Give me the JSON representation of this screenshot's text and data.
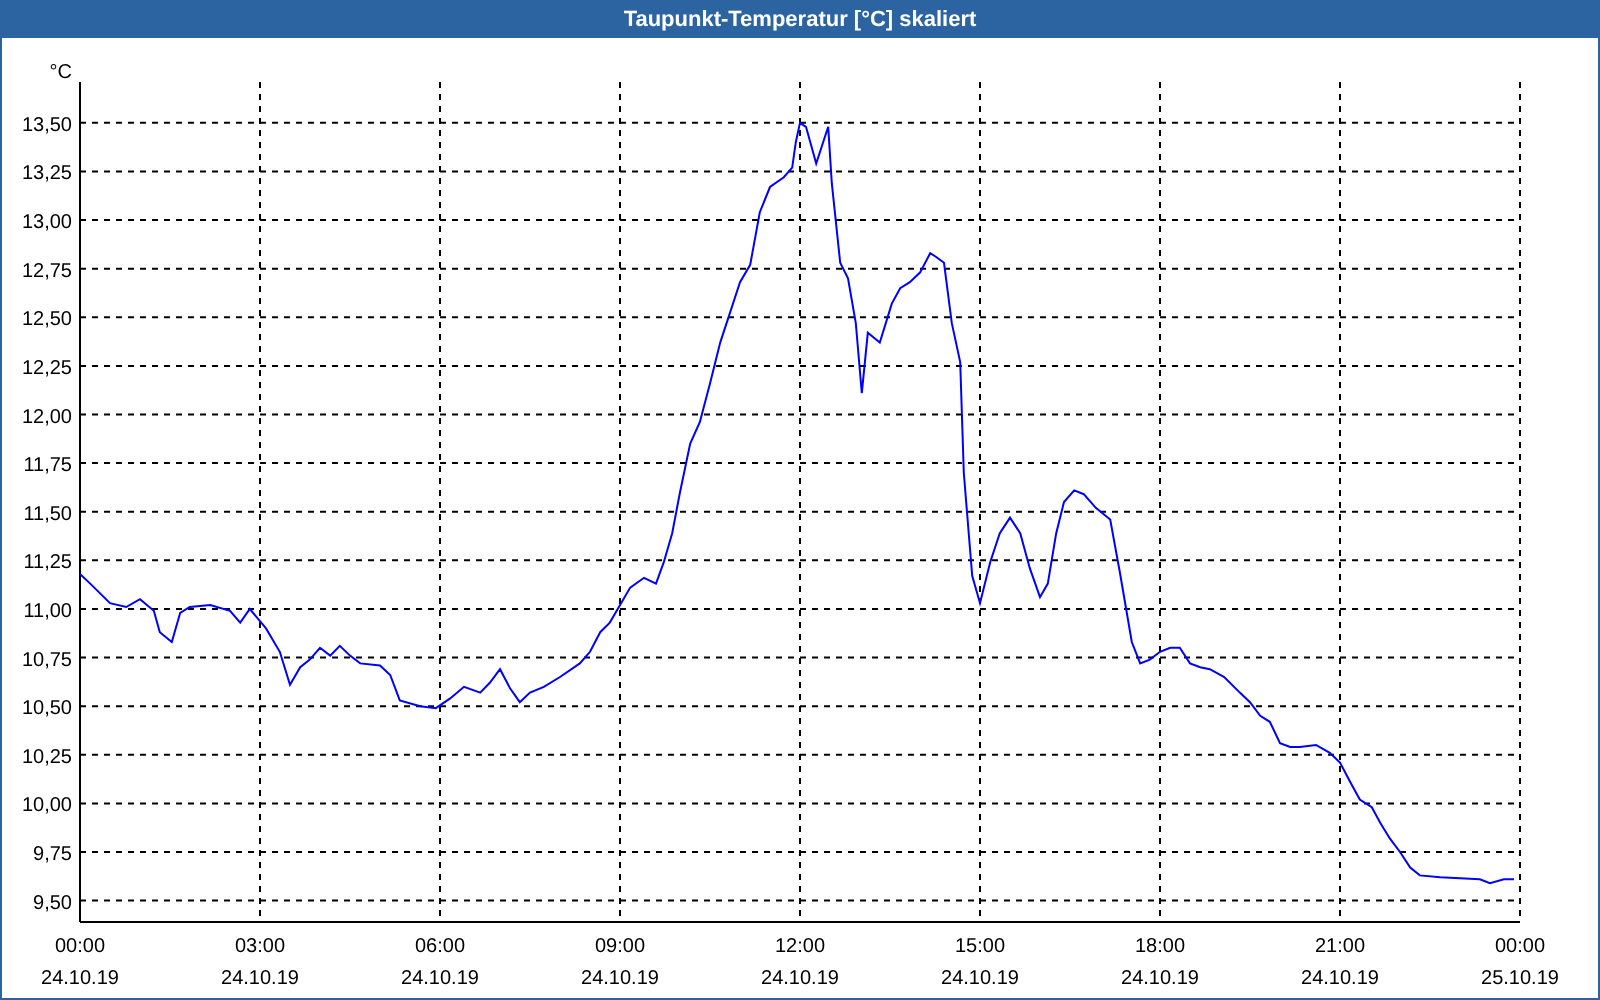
{
  "window": {
    "title": "Taupunkt-Temperatur [°C] skaliert"
  },
  "chart": {
    "chart_data": {
      "type": "line",
      "grid": true,
      "ylabel": "°C",
      "xlim": [
        0,
        24
      ],
      "ylim": [
        9.39,
        13.71
      ],
      "yticks": [
        {
          "value": 9.5,
          "label": "9,50"
        },
        {
          "value": 9.75,
          "label": "9,75"
        },
        {
          "value": 10,
          "label": "10,00"
        },
        {
          "value": 10.25,
          "label": "10,25"
        },
        {
          "value": 10.5,
          "label": "10,50"
        },
        {
          "value": 10.75,
          "label": "10,75"
        },
        {
          "value": 11,
          "label": "11,00"
        },
        {
          "value": 11.25,
          "label": "11,25"
        },
        {
          "value": 11.5,
          "label": "11,50"
        },
        {
          "value": 11.75,
          "label": "11,75"
        },
        {
          "value": 12,
          "label": "12,00"
        },
        {
          "value": 12.25,
          "label": "12,25"
        },
        {
          "value": 12.5,
          "label": "12,50"
        },
        {
          "value": 12.75,
          "label": "12,75"
        },
        {
          "value": 13,
          "label": "13,00"
        },
        {
          "value": 13.25,
          "label": "13,25"
        },
        {
          "value": 13.5,
          "label": "13,50"
        }
      ],
      "xticks": [
        {
          "value": 0,
          "label": "00:00"
        },
        {
          "value": 3,
          "label": "03:00"
        },
        {
          "value": 6,
          "label": "06:00"
        },
        {
          "value": 9,
          "label": "09:00"
        },
        {
          "value": 12,
          "label": "12:00"
        },
        {
          "value": 15,
          "label": "15:00"
        },
        {
          "value": 18,
          "label": "18:00"
        },
        {
          "value": 21,
          "label": "21:00"
        },
        {
          "value": 24,
          "label": "00:00"
        }
      ],
      "x": [
        0,
        0.17,
        0.5,
        0.77,
        1,
        1.23,
        1.33,
        1.53,
        1.67,
        1.83,
        2.17,
        2.5,
        2.67,
        2.83,
        3.1,
        3.33,
        3.5,
        3.67,
        3.83,
        4,
        4.17,
        4.33,
        4.5,
        4.67,
        5,
        5.17,
        5.33,
        5.67,
        5.93,
        6.17,
        6.4,
        6.67,
        6.83,
        7,
        7.17,
        7.33,
        7.5,
        7.73,
        8,
        8.33,
        8.5,
        8.67,
        8.83,
        9.17,
        9.4,
        9.6,
        9.73,
        9.87,
        10,
        10.17,
        10.33,
        10.5,
        10.67,
        10.83,
        11,
        11.17,
        11.33,
        11.5,
        11.73,
        11.87,
        11.93,
        12,
        12.1,
        12.27,
        12.47,
        12.53,
        12.67,
        12.8,
        12.93,
        13.03,
        13.13,
        13.33,
        13.53,
        13.67,
        13.83,
        14,
        14.17,
        14.27,
        14.4,
        14.53,
        14.67,
        14.73,
        14.87,
        15,
        15.17,
        15.33,
        15.5,
        15.67,
        15.83,
        16,
        16.13,
        16.27,
        16.4,
        16.57,
        16.73,
        16.93,
        17.17,
        17.33,
        17.53,
        17.67,
        17.83,
        18,
        18.17,
        18.33,
        18.5,
        18.67,
        18.83,
        19.07,
        19.33,
        19.5,
        19.67,
        19.83,
        20,
        20.17,
        20.33,
        20.6,
        20.83,
        21,
        21.17,
        21.33,
        21.53,
        21.67,
        21.83,
        22,
        22.17,
        22.33,
        22.67,
        23.33,
        23.5,
        23.73,
        23.9
      ],
      "series": [
        {
          "color": "#0000ff",
          "values": [
            11.18,
            11.13,
            11.03,
            11.01,
            11.05,
            10.99,
            10.88,
            10.83,
            10.98,
            11.01,
            11.02,
            10.99,
            10.93,
            11.0,
            10.9,
            10.78,
            10.61,
            10.7,
            10.74,
            10.8,
            10.76,
            10.81,
            10.76,
            10.72,
            10.71,
            10.66,
            10.53,
            10.5,
            10.49,
            10.54,
            10.6,
            10.57,
            10.62,
            10.69,
            10.59,
            10.52,
            10.57,
            10.6,
            10.65,
            10.72,
            10.78,
            10.88,
            10.93,
            11.11,
            11.16,
            11.13,
            11.24,
            11.39,
            11.6,
            11.85,
            11.96,
            12.16,
            12.37,
            12.52,
            12.68,
            12.77,
            13.04,
            13.17,
            13.22,
            13.27,
            13.4,
            13.5,
            13.48,
            13.29,
            13.48,
            13.19,
            12.78,
            12.7,
            12.47,
            12.11,
            12.42,
            12.37,
            12.57,
            12.65,
            12.68,
            12.73,
            12.83,
            12.81,
            12.78,
            12.47,
            12.27,
            11.7,
            11.17,
            11.03,
            11.24,
            11.39,
            11.47,
            11.39,
            11.21,
            11.06,
            11.13,
            11.39,
            11.55,
            11.61,
            11.59,
            11.52,
            11.46,
            11.19,
            10.83,
            10.72,
            10.74,
            10.78,
            10.8,
            10.8,
            10.72,
            10.7,
            10.69,
            10.65,
            10.57,
            10.52,
            10.45,
            10.42,
            10.31,
            10.29,
            10.29,
            10.3,
            10.26,
            10.21,
            10.11,
            10.02,
            9.98,
            9.9,
            9.82,
            9.75,
            9.67,
            9.63,
            9.62,
            9.61,
            9.59,
            9.61,
            9.61
          ]
        }
      ]
    },
    "date_labels": [
      "24.10.19",
      "24.10.19",
      "24.10.19",
      "24.10.19",
      "24.10.19",
      "24.10.19",
      "24.10.19",
      "24.10.19",
      "25.10.19"
    ]
  }
}
